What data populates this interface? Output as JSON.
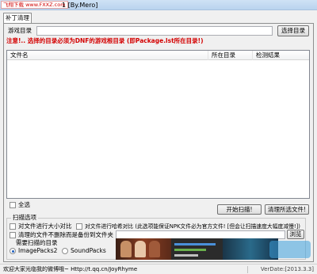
{
  "window": {
    "title": "1 [By.Mero]",
    "watermark_badge": "飞翔下载 www.FXXZ.com"
  },
  "tabs": [
    {
      "label": "补丁清理"
    }
  ],
  "game_dir": {
    "label": "游戏目录",
    "value": "",
    "browse_label": "选择目录"
  },
  "notice": "注意!.. 选择的目录必须为DNF的游戏根目录 (即Package.lst所在目录!)",
  "file_list": {
    "columns": [
      "文件名",
      "所在目录",
      "检测结果"
    ],
    "rows": []
  },
  "select_all": {
    "label": "全选",
    "checked": false
  },
  "actions": {
    "scan_label": "开始扫描!",
    "clean_label": "清理所选文件!"
  },
  "scan_options": {
    "title": "扫描选项",
    "compare_size_label": "对文件进行大小对比",
    "compare_hash_label": "对文件进行哈希对比 (此选项能保证NPK文件必为官方文件! [但会让扫描速度大幅度减慢!])",
    "backup_label": "清理的文件不删除而是备份到文件夹",
    "backup_path": "",
    "browse_label": "浏览",
    "target_dir_label": "需要扫描的目录",
    "radio_imagepacks2": "ImagePacks2",
    "radio_soundpacks": "SoundPacks",
    "selected": "ImagePacks2"
  },
  "status": {
    "left": "欢迎大家光临我的微博哦~ Http://t.qq.cn/JoyRhyme",
    "right": "VerDate:[2013.3.3]"
  },
  "colors": {
    "notice": "#d40000",
    "title_bar": "#c4dbf3",
    "panel_bg": "#f0f0f0"
  }
}
